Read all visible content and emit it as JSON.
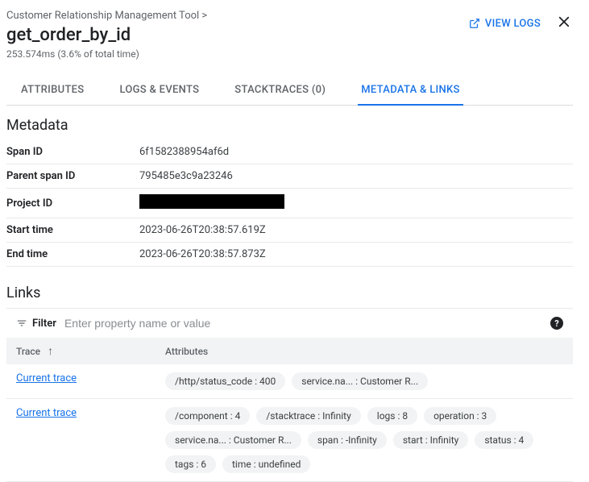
{
  "header": {
    "breadcrumb": "Customer Relationship Management Tool >",
    "title": "get_order_by_id",
    "subtitle": "253.574ms  (3.6% of total time)",
    "view_logs_label": "VIEW LOGS"
  },
  "tabs": [
    {
      "label": "ATTRIBUTES",
      "active": false
    },
    {
      "label": "LOGS & EVENTS",
      "active": false
    },
    {
      "label": "STACKTRACES (0)",
      "active": false
    },
    {
      "label": "METADATA & LINKS",
      "active": true
    }
  ],
  "metadata": {
    "section_title": "Metadata",
    "rows": [
      {
        "key": "Span ID",
        "value": "6f1582388954af6d"
      },
      {
        "key": "Parent span ID",
        "value": "795485e3c9a23246"
      },
      {
        "key": "Project ID",
        "value": "",
        "redacted": true
      },
      {
        "key": "Start time",
        "value": "2023-06-26T20:38:57.619Z"
      },
      {
        "key": "End time",
        "value": "2023-06-26T20:38:57.873Z"
      }
    ]
  },
  "links": {
    "section_title": "Links",
    "filter_label": "Filter",
    "filter_placeholder": "Enter property name or value",
    "columns": {
      "trace": "Trace",
      "attributes": "Attributes"
    },
    "rows": [
      {
        "trace_label": "Current trace",
        "chips": [
          "/http/status_code : 400",
          "service.na... : Customer R..."
        ]
      },
      {
        "trace_label": "Current trace",
        "chips": [
          "/component : 4",
          "/stacktrace : Infinity",
          "logs : 8",
          "operation : 3",
          "service.na... : Customer R...",
          "span : -Infinity",
          "start : Infinity",
          "status : 4",
          "tags : 6",
          "time : undefined"
        ]
      }
    ]
  }
}
